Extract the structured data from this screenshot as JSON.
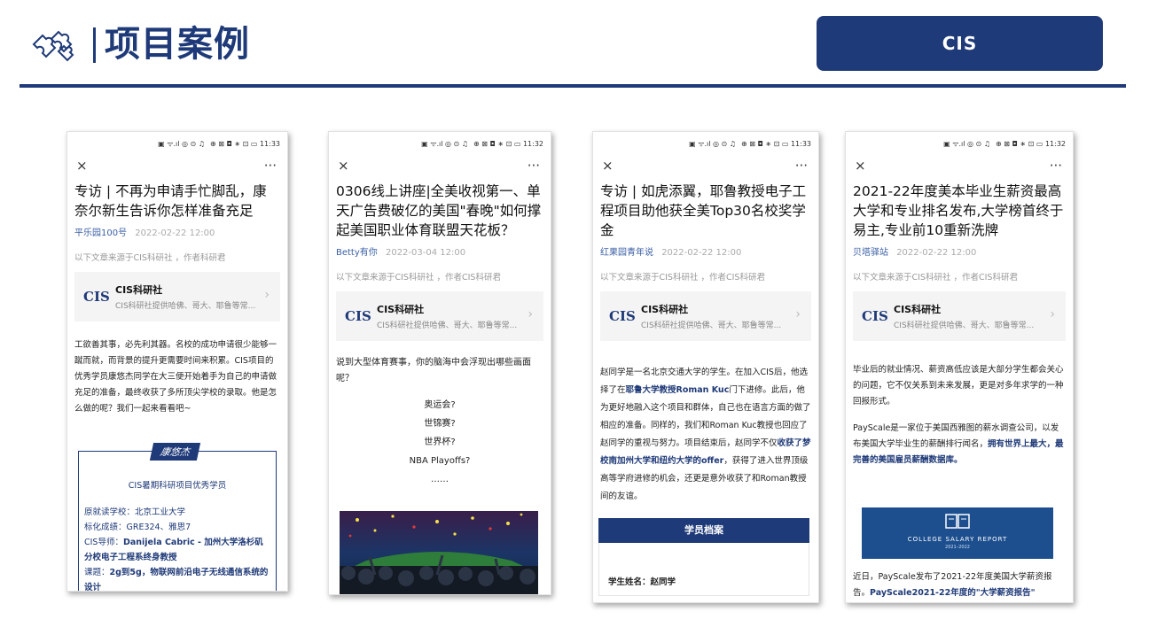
{
  "header": {
    "title": "项目案例",
    "badge": "CIS"
  },
  "common": {
    "close": "×",
    "more": "···",
    "card_logo": "CIS",
    "card_name": "CIS科研社",
    "card_desc": "CIS科研社提供哈佛、哥大、耶鲁等常...",
    "card_chev": "›"
  },
  "phones": [
    {
      "status_left": "▣ ᯤ.ıl ◎ ⊙ ♫",
      "status_right": "⊕ ⊠ ◘ ∗ ⊡ ▭ 11:33",
      "title": "专访 | 不再为申请手忙脚乱，康奈尔新生告诉你怎样准备充足",
      "author": "平乐园100号",
      "date": "2022-02-22 12:00",
      "source_note": "以下文章来源于CIS科研社 ，作者科研君",
      "body": "工欲善其事，必先利其器。名校的成功申请很少能够一蹴而就，而背景的提升更需要时间来积累。CIS项目的优秀学员康悠杰同学在大三便开始着手为自己的申请做充足的准备，最终收获了多所顶尖学校的录取。他是怎么做的呢？我们一起来看看吧~",
      "name_tag": "康悠杰",
      "profile_head": "CIS暑期科研项目优秀学员",
      "profile": {
        "school": "原就读学校：北京工业大学",
        "scores": "标化成绩：GRE324、雅思7",
        "mentor_label": "CIS导师：",
        "mentor": "Danijela Cabric - 加州大学洛杉矶分校电子工程系终身教授",
        "topic_label": "课题：",
        "topic": "2g到5g，物联网前沿电子无线通信系统的设计"
      }
    },
    {
      "status_left": "▣ ᯤ.ıl ◎ ⊙ ♫",
      "status_right": "⊕ ⊠ ◘ ∗ ⊡ ▭ 11:32",
      "title": "0306线上讲座|全美收视第一、单天广告费破亿的美国\"春晚\"如何撑起美国职业体育联盟天花板？",
      "author": "Betty有你",
      "date": "2022-03-04 12:00",
      "source_note": "以下文章来源于CIS科研社 ，作者CIS科研君",
      "intro": "说到大型体育赛事，你的脑海中会浮现出哪些画面呢？",
      "lines": [
        "奥运会?",
        "世锦赛?",
        "世界杯?",
        "NBA Playoffs?",
        "……"
      ]
    },
    {
      "status_left": "▣ ᯤ.ıl ◎ ⊙ ♫",
      "status_right": "⊕ ⊠ ◘ ∗ ⊡ ▭ 11:33",
      "title": "专访 | 如虎添翼，耶鲁教授电子工程项目助他获全美Top30名校奖学金",
      "author": "红果园青年说",
      "date": "2022-02-22 12:00",
      "source_note": "以下文章来源于CIS科研社 ，作者CIS科研君",
      "body_a": "赵同学是一名北京交通大学的学生。在加入CIS后，他选择了在",
      "body_b": "耶鲁大学教授Roman Kuc",
      "body_c": "门下进修。此后，他为更好地融入这个项目和群体，自己也在语言方面的做了相应的准备。同样的，我们和Roman Kuc教授也回应了赵同学的重视与努力。项目结束后，赵同学不仅",
      "body_d": "收获了梦校南加州大学和纽约大学的offer",
      "body_e": "，获得了进入世界顶级高等学府进修的机会，还更是意外收获了和Roman教授间的友谊。",
      "banner": "学员档案",
      "student_name": "学生姓名：赵同学"
    },
    {
      "status_left": "▣ ᯤ.ıl ◎ ⊙ ♫",
      "status_right": "⊕ ⊠ ◘ ∗ ⊡ ▭ 11:32",
      "title": "2021-22年度美本毕业生薪资最高大学和专业排名发布,大学榜首终于易主,专业前10重新洗牌",
      "author": "贝塔驿站",
      "date": "2022-02-22 12:00",
      "source_note": "以下文章来源于CIS科研社 ，作者CIS科研君",
      "body1": "毕业后的就业情况、薪资高低应该是大部分学生都会关心的问题，它不仅关系到未来发展，更是对多年求学的一种回报形式。",
      "body2_a": "PayScale是一家位于美国西雅图的薪水调查公司，以发布美国大学毕业生的薪酬排行闻名，",
      "body2_b": "拥有世界上最大，最完善的美国雇员薪酬数据库。",
      "report_label": "COLLEGE SALARY REPORT",
      "report_year": "2021–2022",
      "body3_a": "近日，PayScale发布了2021-22年度美国大学薪资报告。",
      "body3_b": "PayScale2021-22年度的\"大学薪资报告\""
    }
  ]
}
